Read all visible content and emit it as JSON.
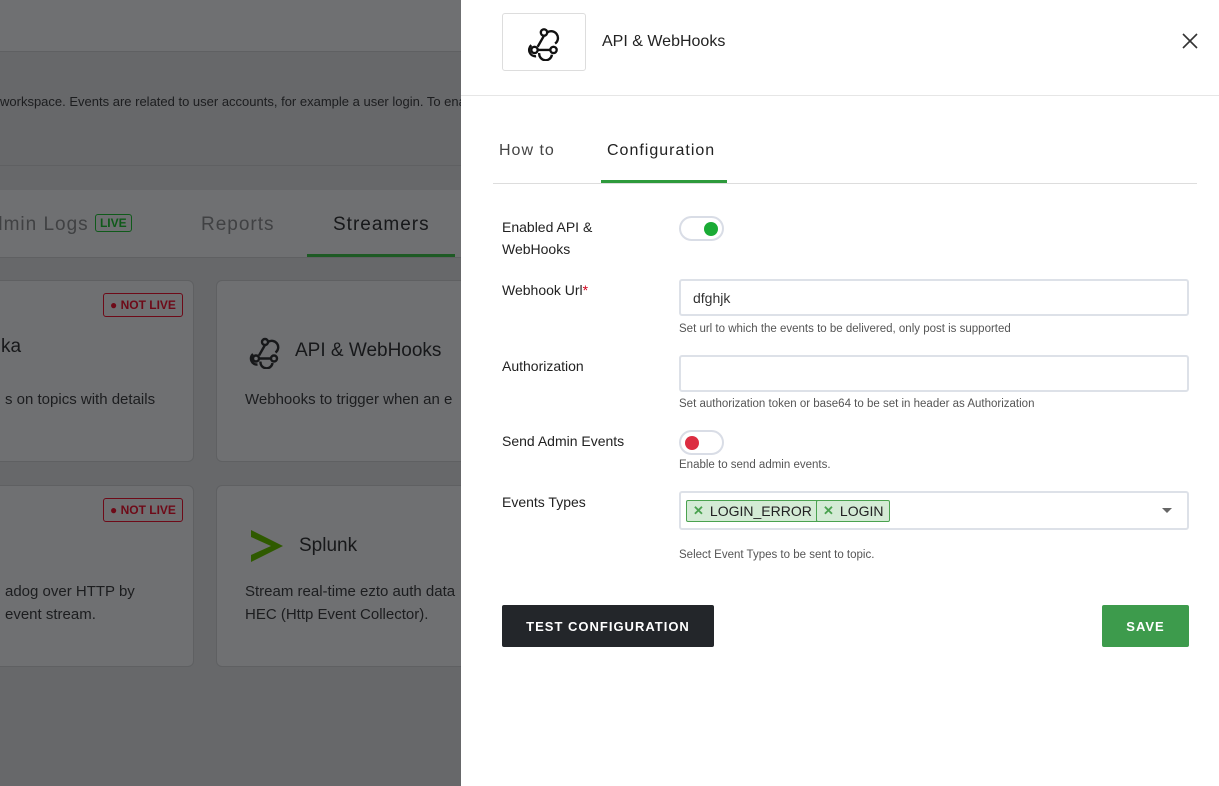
{
  "background": {
    "description": "workspace. Events are related to user accounts, for example a user login. To enal",
    "tabs": [
      {
        "label": "dmin Logs",
        "badge": "LIVE"
      },
      {
        "label": "Reports"
      },
      {
        "label": "Streamers"
      }
    ],
    "cards": [
      {
        "title": "ka",
        "badge": "NOT LIVE",
        "description": [
          "s on topics with details"
        ]
      },
      {
        "title": "API & WebHooks",
        "icon": "webhook-icon",
        "description": [
          "Webhooks to trigger when an e"
        ]
      },
      {
        "title": "",
        "badge": "NOT LIVE",
        "description": [
          "adog over HTTP by",
          "event stream."
        ]
      },
      {
        "title": "Splunk",
        "icon": "splunk-chevron-icon",
        "description": [
          "Stream real-time ezto auth data",
          "HEC (Http Event Collector)."
        ]
      }
    ]
  },
  "panel": {
    "title": "API & WebHooks",
    "icon": "webhook-icon",
    "close_icon": "close-icon",
    "tabs": [
      {
        "label": "How to",
        "active": false
      },
      {
        "label": "Configuration",
        "active": true
      }
    ],
    "form": {
      "enabled": {
        "label": "Enabled API & WebHooks",
        "value": true
      },
      "webhook_url": {
        "label": "Webhook Url",
        "required_mark": "*",
        "value": "dfghjk",
        "help": "Set url to which the events to be delivered, only post is supported"
      },
      "authorization": {
        "label": "Authorization",
        "value": "",
        "help": "Set authorization token or base64 to be set in header as Authorization"
      },
      "send_admin_events": {
        "label": "Send Admin Events",
        "value": false,
        "help": "Enable to send admin events."
      },
      "event_types": {
        "label": "Events Types",
        "selected": [
          "LOGIN_ERROR",
          "LOGIN"
        ],
        "remove_glyph": "✕",
        "help": "Select Event Types to be sent to topic."
      }
    },
    "buttons": {
      "test": "TEST CONFIGURATION",
      "save": "SAVE"
    }
  },
  "colors": {
    "accent": "#2e9a3c",
    "toggle_on": "#1aab35",
    "toggle_off": "#dc2d41",
    "save": "#3d9b4c",
    "test": "#23262a"
  }
}
